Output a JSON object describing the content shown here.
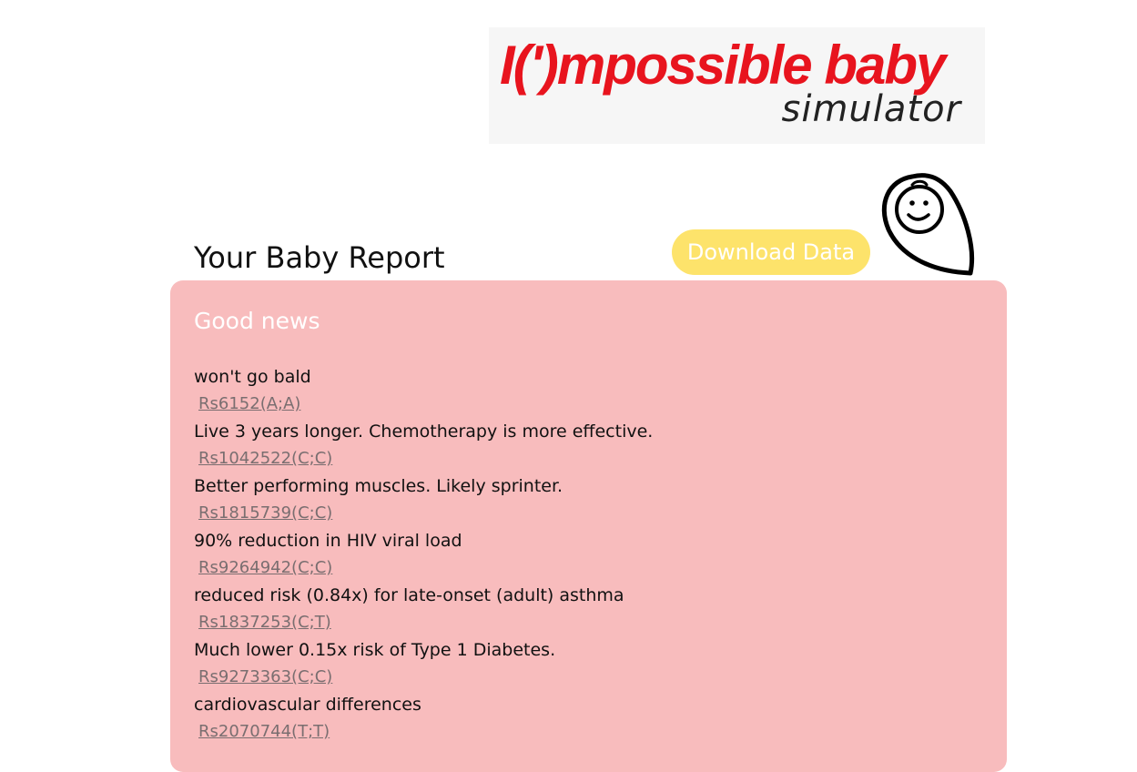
{
  "logo": {
    "title": "I(')mpossible baby",
    "subtitle": "simulator"
  },
  "report": {
    "title": "Your Baby Report",
    "download_label": "Download Data",
    "section_title": "Good news",
    "items": [
      {
        "description": "won't go bald",
        "snp": "Rs6152(A;A)"
      },
      {
        "description": "Live 3 years longer. Chemotherapy is more effective.",
        "snp": "Rs1042522(C;C)"
      },
      {
        "description": "Better performing muscles. Likely sprinter.",
        "snp": "Rs1815739(C;C)"
      },
      {
        "description": "90% reduction in HIV viral load",
        "snp": "Rs9264942(C;C)"
      },
      {
        "description": "reduced risk (0.84x) for late-onset (adult) asthma",
        "snp": "Rs1837253(C;T)"
      },
      {
        "description": "Much lower 0.15x risk of Type 1 Diabetes.",
        "snp": "Rs9273363(C;C)"
      },
      {
        "description": "cardiovascular differences",
        "snp": "Rs2070744(T;T)"
      }
    ]
  },
  "colors": {
    "brand_red": "#e8141e",
    "card_pink": "#f8bcbd",
    "button_yellow": "#fde36b",
    "link_gray": "#7a6e70"
  },
  "icons": {
    "baby": "swaddled-baby-icon"
  }
}
